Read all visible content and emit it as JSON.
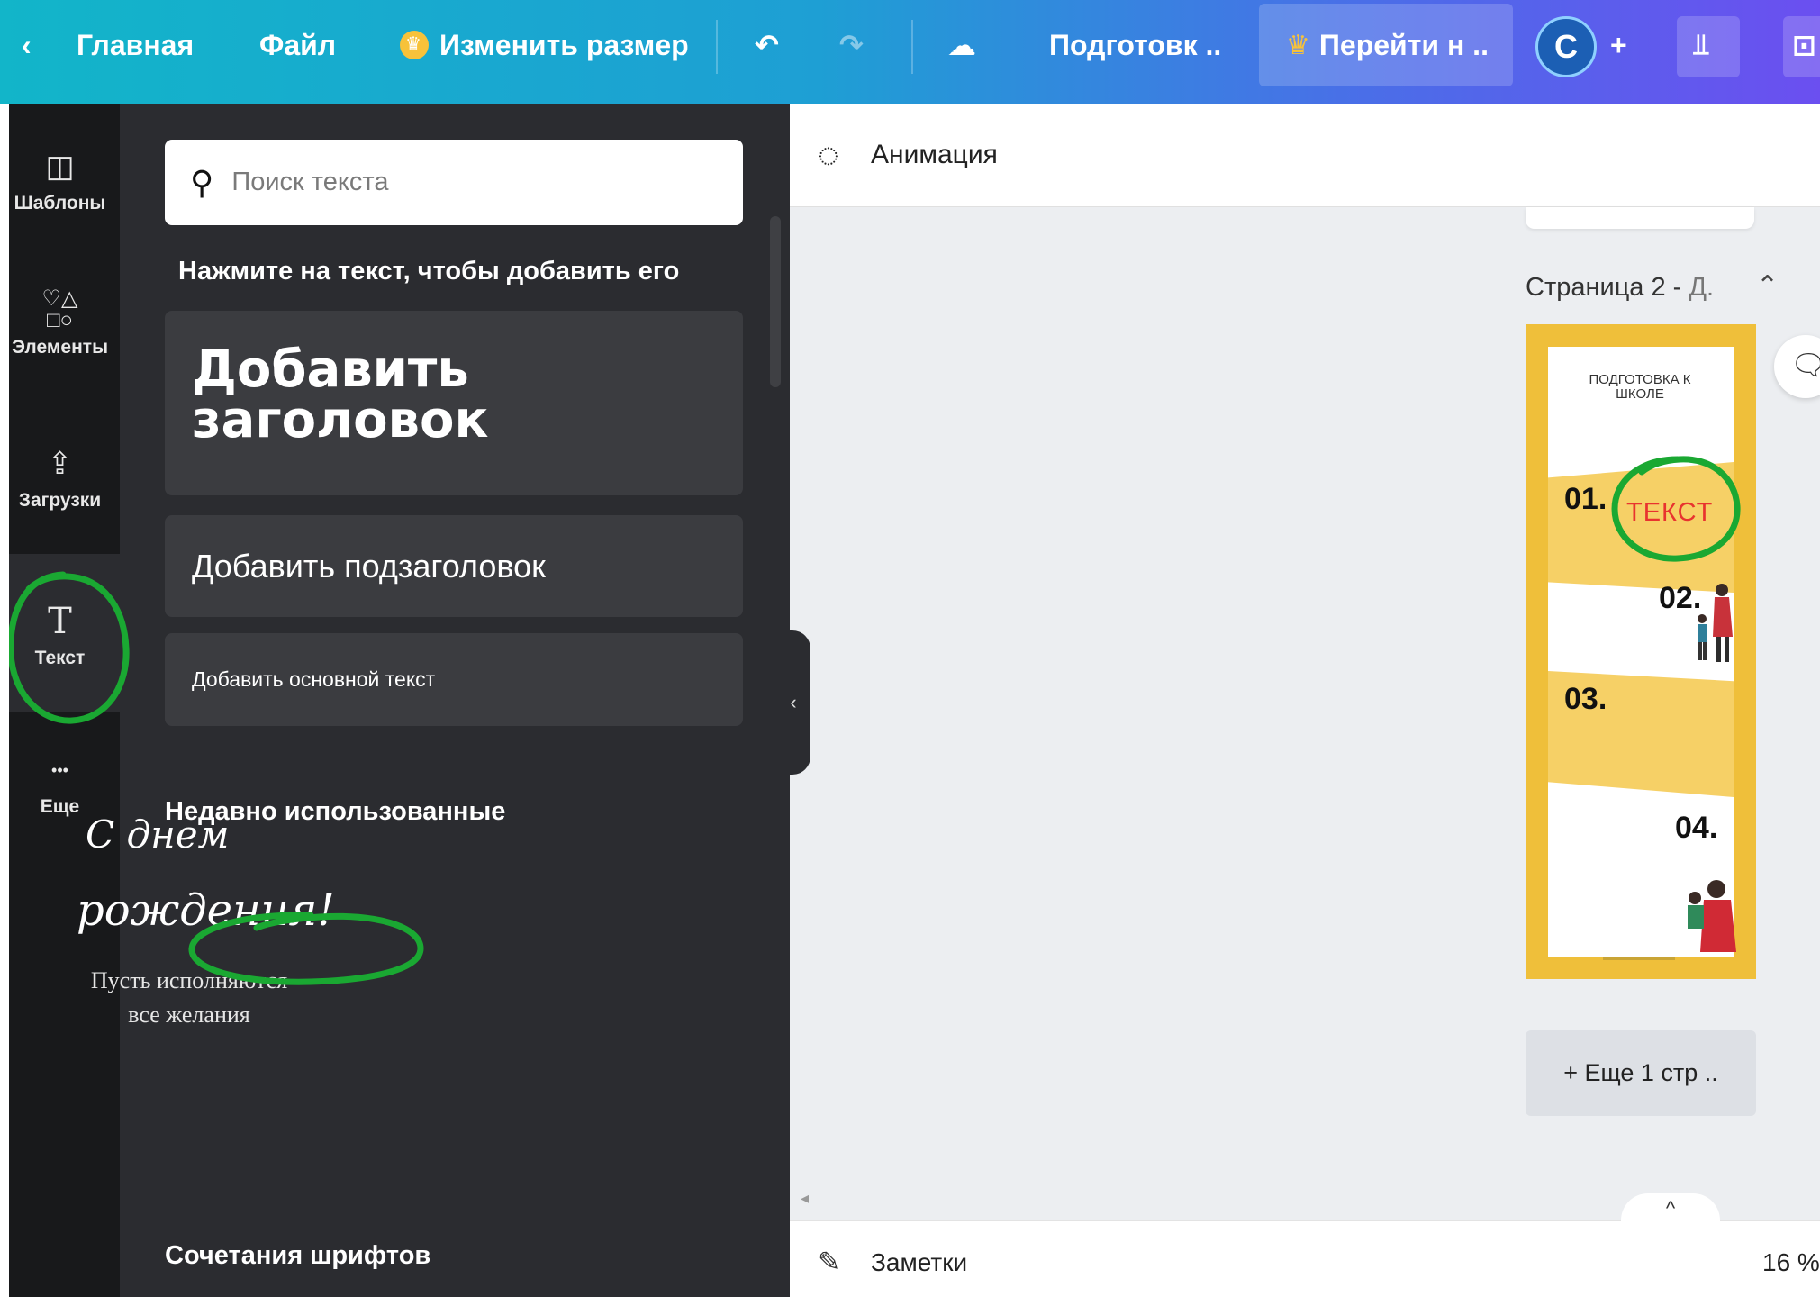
{
  "topbar": {
    "back_glyph": "‹",
    "home_label": "Главная",
    "file_label": "Файл",
    "resize_label": "Изменить размер",
    "undo_glyph": "↶",
    "redo_glyph": "↷",
    "cloud_glyph": "☁",
    "title_label": "Подготовк ..",
    "upgrade_label": "Перейти н ..",
    "avatar_letter": "С",
    "plus_glyph": "+",
    "stats_glyph": "⫫",
    "share_glyph": "⊡",
    "crown_color": "#f7c23a"
  },
  "rail": {
    "items": [
      {
        "id": "templates",
        "icon": "layout-icon",
        "glyph": "◫",
        "label": "Шаблоны"
      },
      {
        "id": "elements",
        "icon": "shapes-icon",
        "glyph": "♡△\n□○",
        "label": "Элементы"
      },
      {
        "id": "uploads",
        "icon": "cloud-upload-icon",
        "glyph": "⇪",
        "label": "Загрузки"
      },
      {
        "id": "text",
        "icon": "text-t-icon",
        "glyph": "T",
        "label": "Текст"
      },
      {
        "id": "more",
        "icon": "more-dots-icon",
        "glyph": "•••",
        "label": "Еще"
      }
    ],
    "active": "text"
  },
  "panel": {
    "search_placeholder": "Поиск текста",
    "hint": "Нажмите на текст, чтобы добавить его",
    "heading_card": "Добавить заголовок",
    "subheading_card": "Добавить подзаголовок",
    "body_card": "Добавить основной текст",
    "recent_title": "Недавно использованные",
    "recent_preview": {
      "line1": "С днем",
      "line2": "рождения!",
      "caption1": "Пусть исполняются",
      "caption2": "все желания"
    },
    "fonts_title": "Сочетания шрифтов",
    "collapse_glyph": "‹"
  },
  "editor": {
    "animation_label": "Анимация",
    "page_label_main": "Страница 2 - ",
    "page_label_rest": "Д.",
    "page_chevron": "⌃",
    "thumbnail": {
      "title": "ПОДГОТОВКА К ШКОЛЕ",
      "n1": "01.",
      "n2": "02.",
      "n3": "03.",
      "n4": "04.",
      "text": "ТЕКСТ",
      "frame_color": "#efbf3a",
      "band_color": "#f6d066",
      "text_color": "#e8332f"
    },
    "add_page_label": "+ Еще 1 стр ..",
    "notes_label": "Заметки",
    "zoom_label": "16 %",
    "bottom_tab_glyph": "^"
  },
  "annotations": {
    "circle_color": "#1aa832"
  }
}
